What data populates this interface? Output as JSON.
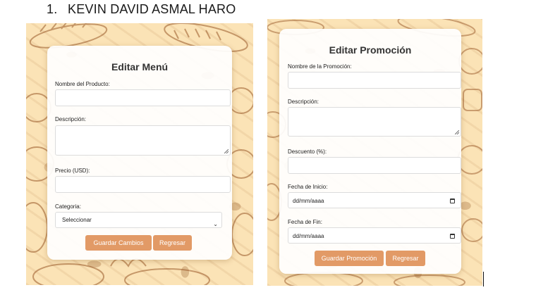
{
  "document": {
    "list_number": "1.",
    "name": "KEVIN DAVID ASMAL HARO"
  },
  "menu_form": {
    "title": "Editar Menú",
    "product_name_label": "Nombre del Producto:",
    "description_label": "Descripción:",
    "price_label": "Precio (USD):",
    "category_label": "Categoria:",
    "category_selected": "Seleccionar",
    "save_button": "Guardar Cambios",
    "back_button": "Regresar"
  },
  "promo_form": {
    "title": "Editar Promoción",
    "promo_name_label": "Nombre de la Promoción:",
    "description_label": "Descripción:",
    "discount_label": "Descuento (%):",
    "start_date_label": "Fecha de Inicio:",
    "start_date_value": "dd/mm/aaaa",
    "end_date_label": "Fecha de Fin:",
    "end_date_value": "dd/mm/aaaa",
    "save_button": "Guardar Promoción",
    "back_button": "Regresar"
  },
  "colors": {
    "background_pattern": "#fbe3b6",
    "button": "#e29a66",
    "card": "#ffffff"
  },
  "icons": {
    "select_arrow": "chevron-down-icon",
    "date_picker": "calendar-icon",
    "textarea_resize": "resize-handle-icon"
  }
}
